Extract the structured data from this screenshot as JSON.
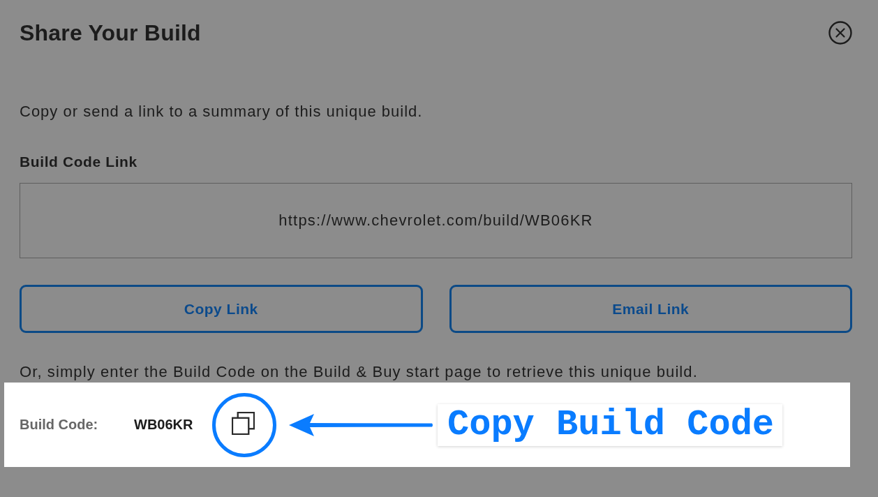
{
  "dialog": {
    "title": "Share Your Build",
    "description": "Copy or send a link to a summary of this unique build.",
    "link_label": "Build Code Link",
    "link_value": "https://www.chevrolet.com/build/WB06KR",
    "buttons": [
      "Copy Link",
      "Email Link"
    ],
    "hint": "Or, simply enter the Build Code on the Build & Buy start page to retrieve this unique build.",
    "build_code": {
      "label": "Build Code:",
      "value": "WB06KR"
    }
  },
  "annotation": {
    "callout": "Copy Build Code"
  }
}
